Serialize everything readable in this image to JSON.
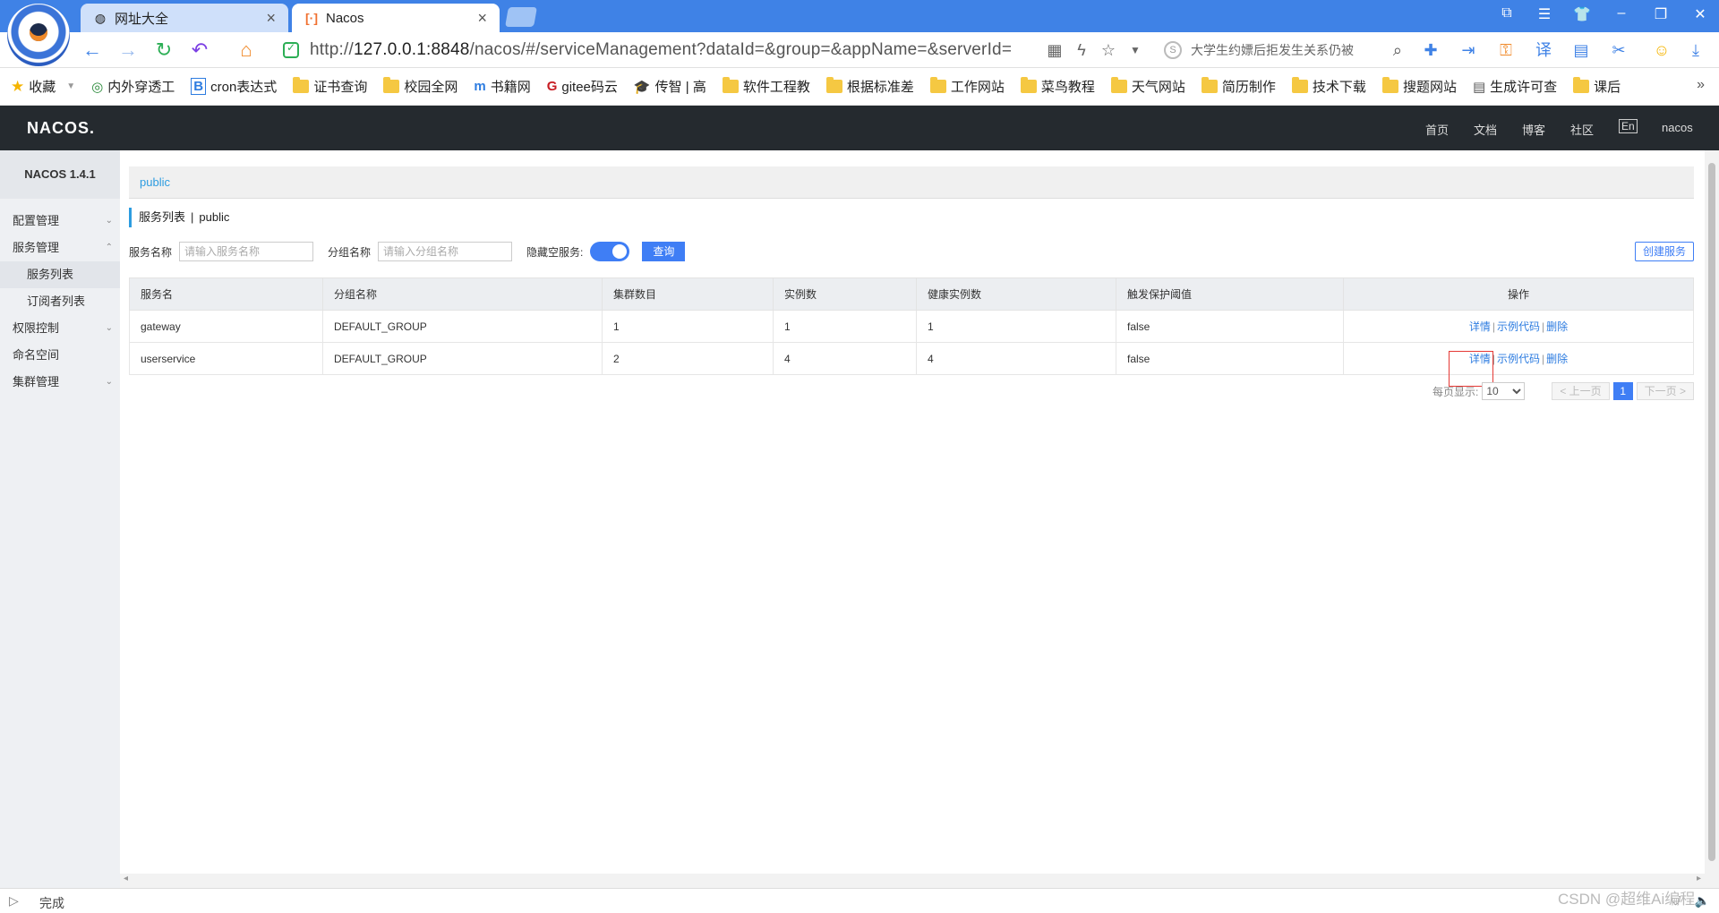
{
  "browser": {
    "tabs": [
      {
        "title": "网址大全"
      },
      {
        "title": "Nacos"
      }
    ],
    "url_prefix": "http://",
    "url_host": "127.0.0.1:8848",
    "url_path": "/nacos/#/serviceManagement?dataId=&group=&appName=&serverId=",
    "search_text": "大学生约嫖后拒发生关系仍被",
    "bookmarks": [
      {
        "label": "收藏",
        "icon": "star-icon"
      },
      {
        "label": "内外穿透工",
        "icon": "globe-icon"
      },
      {
        "label": "cron表达式",
        "icon": "b-icon"
      },
      {
        "label": "证书查询",
        "icon": "folder-icon"
      },
      {
        "label": "校园全网",
        "icon": "folder-icon"
      },
      {
        "label": "书籍网",
        "icon": "book-icon"
      },
      {
        "label": "gitee码云",
        "icon": "gitee-icon"
      },
      {
        "label": "传智 | 高",
        "icon": "cap-icon"
      },
      {
        "label": "软件工程教",
        "icon": "folder-icon"
      },
      {
        "label": "根据标准差",
        "icon": "folder-icon"
      },
      {
        "label": "工作网站",
        "icon": "folder-icon"
      },
      {
        "label": "菜鸟教程",
        "icon": "folder-icon"
      },
      {
        "label": "天气网站",
        "icon": "folder-icon"
      },
      {
        "label": "简历制作",
        "icon": "folder-icon"
      },
      {
        "label": "技术下载",
        "icon": "folder-icon"
      },
      {
        "label": "搜题网站",
        "icon": "folder-icon"
      },
      {
        "label": "生成许可查",
        "icon": "doc-icon"
      },
      {
        "label": "课后",
        "icon": "folder-icon"
      }
    ],
    "status": "完成",
    "watermark": "CSDN @超维Ai编程"
  },
  "nacos": {
    "logo": "NACOS.",
    "header_nav": [
      "首页",
      "文档",
      "博客",
      "社区",
      "En",
      "nacos"
    ],
    "version": "NACOS 1.4.1",
    "sidebar": [
      {
        "label": "配置管理",
        "caret": "⌄"
      },
      {
        "label": "服务管理",
        "caret": "⌃"
      },
      {
        "label": "服务列表",
        "sub": true,
        "active": true
      },
      {
        "label": "订阅者列表",
        "sub": true
      },
      {
        "label": "权限控制",
        "caret": "⌄"
      },
      {
        "label": "命名空间"
      },
      {
        "label": "集群管理",
        "caret": "⌄"
      }
    ],
    "namespace": "public",
    "breadcrumb": {
      "title": "服务列表",
      "sep": "|",
      "namespace": "public"
    },
    "filters": {
      "service_label": "服务名称",
      "service_placeholder": "请输入服务名称",
      "group_label": "分组名称",
      "group_placeholder": "请输入分组名称",
      "hide_empty_label": "隐藏空服务:",
      "query_button": "查询",
      "create_button": "创建服务"
    },
    "table": {
      "headers": [
        "服务名",
        "分组名称",
        "集群数目",
        "实例数",
        "健康实例数",
        "触发保护阈值",
        "操作"
      ],
      "rows": [
        {
          "name": "gateway",
          "group": "DEFAULT_GROUP",
          "clusters": "1",
          "instances": "1",
          "healthy": "1",
          "threshold": "false"
        },
        {
          "name": "userservice",
          "group": "DEFAULT_GROUP",
          "clusters": "2",
          "instances": "4",
          "healthy": "4",
          "threshold": "false"
        }
      ],
      "actions": {
        "detail": "详情",
        "sample": "示例代码",
        "delete": "删除",
        "sep": "|"
      }
    },
    "pager": {
      "page_size_label": "每页显示:",
      "page_size": "10",
      "prev": "< 上一页",
      "current": "1",
      "next": "下一页 >"
    }
  },
  "colors": {
    "accent": "#3f7ef5",
    "header": "#252a2f",
    "chrome": "#3f82e6",
    "highlight": "#e53935"
  }
}
